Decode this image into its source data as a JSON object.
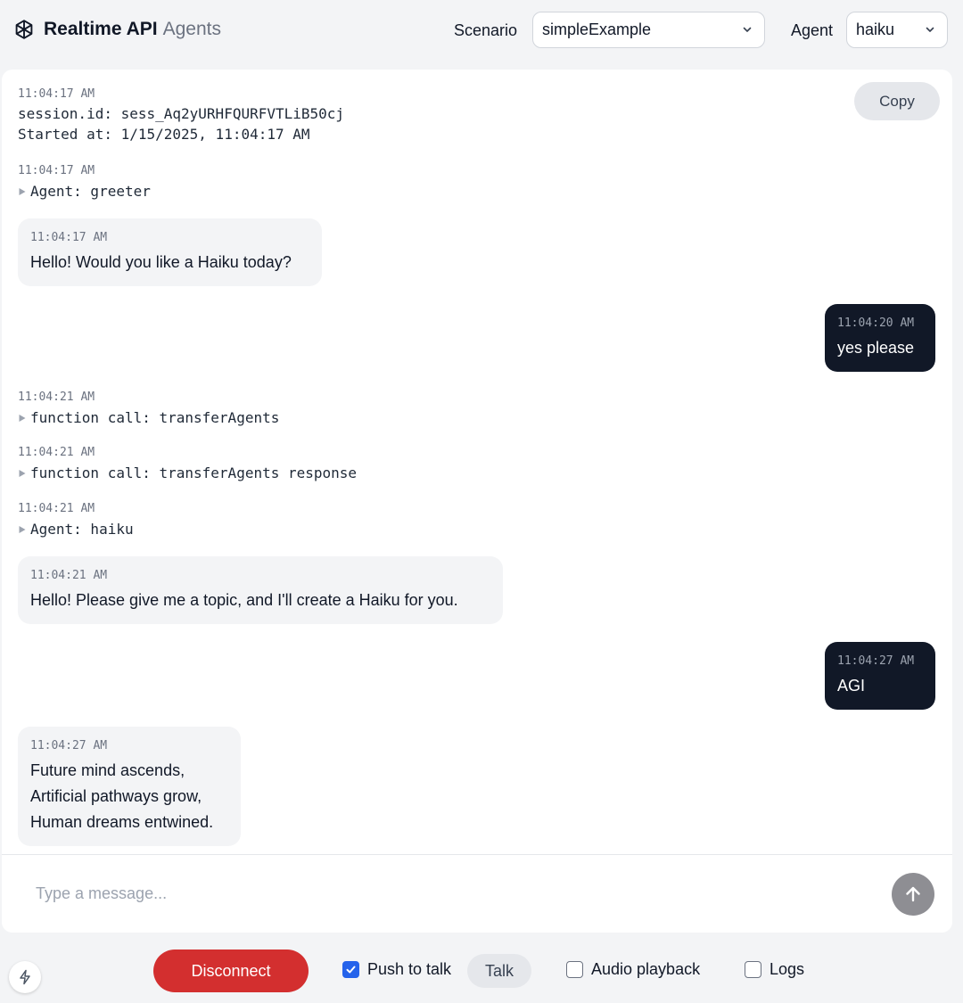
{
  "header": {
    "title": "Realtime API",
    "subtitle": "Agents",
    "scenario_label": "Scenario",
    "scenario_value": "simpleExample",
    "agent_label": "Agent",
    "agent_value": "haiku"
  },
  "transcript": {
    "copy_label": "Copy",
    "session": {
      "ts": "11:04:17 AM",
      "line1": "session.id: sess_Aq2yURHFQURFVTLiB50cj",
      "line2": "Started at: 1/15/2025, 11:04:17 AM"
    },
    "events": [
      {
        "ts": "11:04:17 AM",
        "text": "Agent: greeter"
      },
      {
        "ts": "11:04:21 AM",
        "text": "function call: transferAgents"
      },
      {
        "ts": "11:04:21 AM",
        "text": "function call: transferAgents response"
      },
      {
        "ts": "11:04:21 AM",
        "text": "Agent: haiku"
      }
    ],
    "messages": [
      {
        "role": "assistant",
        "ts": "11:04:17 AM",
        "lines": [
          "Hello! Would you like a Haiku today?"
        ]
      },
      {
        "role": "user",
        "ts": "11:04:20 AM",
        "lines": [
          "yes please"
        ]
      },
      {
        "role": "assistant",
        "ts": "11:04:21 AM",
        "lines": [
          "Hello! Please give me a topic, and I'll create a Haiku for you."
        ]
      },
      {
        "role": "user",
        "ts": "11:04:27 AM",
        "lines": [
          "AGI"
        ]
      },
      {
        "role": "assistant",
        "ts": "11:04:27 AM",
        "lines": [
          "Future mind ascends,",
          "Artificial pathways grow,",
          "Human dreams entwined."
        ]
      }
    ]
  },
  "composer": {
    "placeholder": "Type a message...",
    "value": ""
  },
  "bottom_toolbar": {
    "disconnect_label": "Disconnect",
    "push_to_talk_label": "Push to talk",
    "push_to_talk_checked": true,
    "talk_label": "Talk",
    "audio_playback_label": "Audio playback",
    "audio_playback_checked": false,
    "logs_label": "Logs",
    "logs_checked": false
  },
  "colors": {
    "page_bg": "#f3f4f6",
    "user_bubble": "#111827",
    "assistant_bubble": "#f3f4f6",
    "disconnect": "#d32f2f",
    "checkbox_checked": "#2563eb",
    "send_button": "#8e8e93"
  },
  "icons": [
    "openai-logo-icon",
    "chevron-down-icon",
    "caret-right-icon",
    "arrow-up-icon",
    "bolt-icon",
    "checkmark-icon"
  ]
}
